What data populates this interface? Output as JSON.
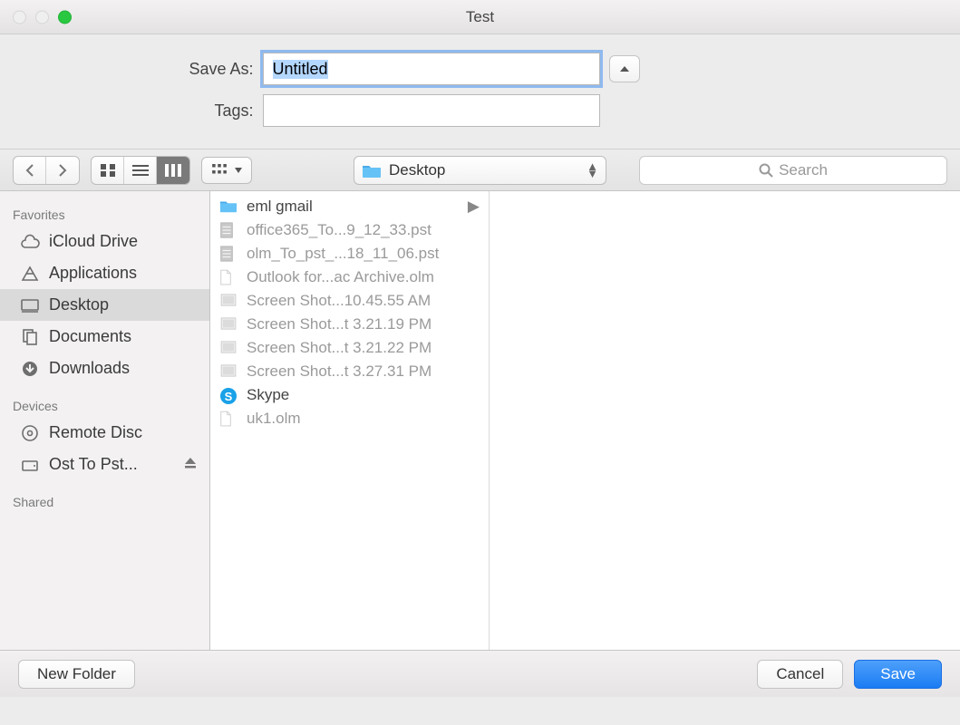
{
  "window": {
    "title": "Test"
  },
  "form": {
    "saveas_label": "Save As:",
    "saveas_value": "Untitled",
    "tags_label": "Tags:",
    "tags_value": ""
  },
  "toolbar": {
    "location_label": "Desktop",
    "search_placeholder": "Search"
  },
  "sidebar": {
    "sections": {
      "favorites": "Favorites",
      "devices": "Devices",
      "shared": "Shared"
    },
    "favorites": [
      {
        "label": "iCloud Drive",
        "icon": "cloud"
      },
      {
        "label": "Applications",
        "icon": "apps"
      },
      {
        "label": "Desktop",
        "icon": "desktop",
        "selected": true
      },
      {
        "label": "Documents",
        "icon": "documents"
      },
      {
        "label": "Downloads",
        "icon": "downloads"
      }
    ],
    "devices": [
      {
        "label": "Remote Disc",
        "icon": "disc"
      },
      {
        "label": "Ost To Pst...",
        "icon": "drive",
        "eject": true
      }
    ]
  },
  "files": [
    {
      "name": "eml gmail",
      "type": "folder",
      "enabled": true
    },
    {
      "name": "office365_To...9_12_33.pst",
      "type": "doc",
      "enabled": false
    },
    {
      "name": "olm_To_pst_...18_11_06.pst",
      "type": "doc",
      "enabled": false
    },
    {
      "name": "Outlook for...ac Archive.olm",
      "type": "file",
      "enabled": false
    },
    {
      "name": "Screen Shot...10.45.55 AM",
      "type": "image",
      "enabled": false
    },
    {
      "name": "Screen Shot...t 3.21.19 PM",
      "type": "image",
      "enabled": false
    },
    {
      "name": "Screen Shot...t 3.21.22 PM",
      "type": "image",
      "enabled": false
    },
    {
      "name": "Screen Shot...t 3.27.31 PM",
      "type": "image",
      "enabled": false
    },
    {
      "name": "Skype",
      "type": "skype",
      "enabled": true
    },
    {
      "name": "uk1.olm",
      "type": "file",
      "enabled": false
    }
  ],
  "buttons": {
    "new_folder": "New Folder",
    "cancel": "Cancel",
    "save": "Save"
  }
}
